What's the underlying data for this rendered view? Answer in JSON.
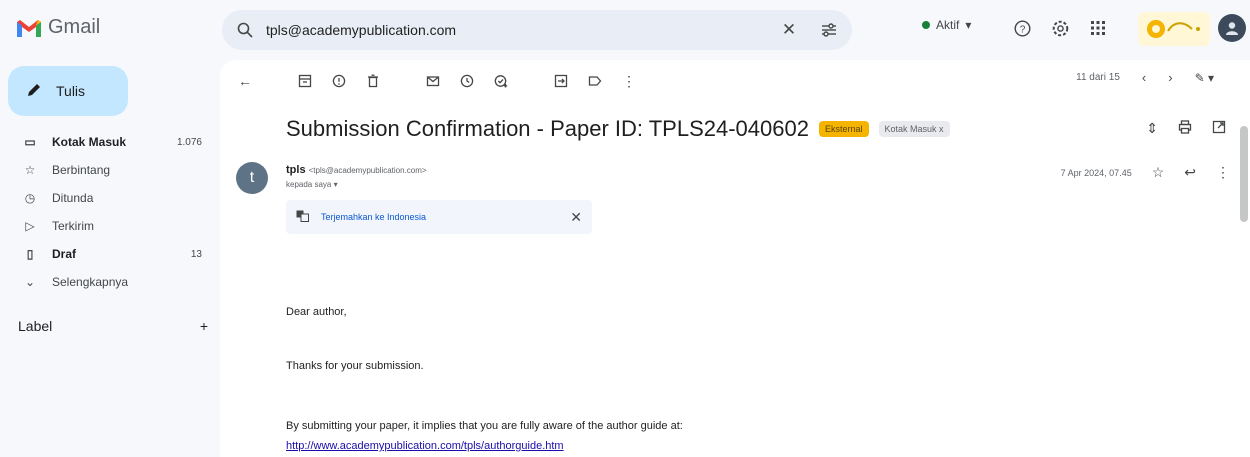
{
  "app": {
    "name": "Gmail"
  },
  "search": {
    "value": "tpls@academypublication.com"
  },
  "status": {
    "label": "Aktif",
    "color": "#188038"
  },
  "compose": {
    "label": "Tulis"
  },
  "sidebar": {
    "items": [
      {
        "label": "Kotak Masuk",
        "count": "1.076",
        "icon": "inbox-icon",
        "bold": true
      },
      {
        "label": "Berbintang",
        "count": "",
        "icon": "star-icon",
        "bold": false
      },
      {
        "label": "Ditunda",
        "count": "",
        "icon": "clock-icon",
        "bold": false
      },
      {
        "label": "Terkirim",
        "count": "",
        "icon": "send-icon",
        "bold": false
      },
      {
        "label": "Draf",
        "count": "13",
        "icon": "draft-icon",
        "bold": true
      },
      {
        "label": "Selengkapnya",
        "count": "",
        "icon": "chevron-down-icon",
        "bold": false
      }
    ],
    "label_heading": "Label"
  },
  "pager": {
    "text": "11 dari 15"
  },
  "email": {
    "subject": "Submission Confirmation - Paper ID: TPLS24-040602",
    "badge_external": "Eksternal",
    "badge_inbox": "Kotak Masuk x",
    "sender_initial": "t",
    "sender_name": "tpls",
    "sender_address": "<tpls@academypublication.com>",
    "recipient": "kepada saya",
    "date": "7 Apr 2024, 07.45",
    "translate_label": "Terjemahkan ke Indonesia",
    "body": {
      "greeting": "Dear author,",
      "thanks": "Thanks for your submission.",
      "guide_text": "By submitting your paper, it implies that you are fully aware of the author guide at:",
      "guide_link": "http://www.academypublication.com/tpls/authorguide.htm"
    }
  }
}
